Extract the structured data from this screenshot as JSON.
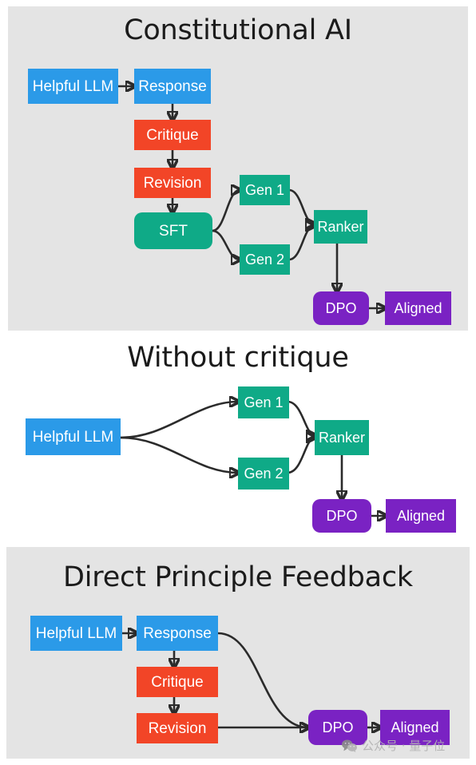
{
  "figure": {
    "title_font_color": "#1b1b1b",
    "panel_bg_gray": "#e4e4e4",
    "panel_bg_white": "#ffffff"
  },
  "colors": {
    "blue": "#2b9ae8",
    "red": "#f24527",
    "green": "#0faa87",
    "purple": "#7a22c3",
    "arrow": "#2b2b2b"
  },
  "panels": [
    {
      "id": "constitutional-ai",
      "title": "Constitutional AI",
      "nodes": {
        "helpful_llm": "Helpful LLM",
        "response": "Response",
        "critique": "Critique",
        "revision": "Revision",
        "sft": "SFT",
        "gen1": "Gen 1",
        "gen2": "Gen 2",
        "ranker": "Ranker",
        "dpo": "DPO",
        "aligned": "Aligned"
      }
    },
    {
      "id": "without-critique",
      "title": "Without critique",
      "nodes": {
        "helpful_llm": "Helpful LLM",
        "gen1": "Gen 1",
        "gen2": "Gen 2",
        "ranker": "Ranker",
        "dpo": "DPO",
        "aligned": "Aligned"
      }
    },
    {
      "id": "direct-principle-feedback",
      "title": "Direct Principle Feedback",
      "nodes": {
        "helpful_llm": "Helpful LLM",
        "response": "Response",
        "critique": "Critique",
        "revision": "Revision",
        "dpo": "DPO",
        "aligned": "Aligned"
      }
    }
  ],
  "watermark": {
    "icon": "wechat-icon",
    "text": "公众号 · 量子位"
  }
}
